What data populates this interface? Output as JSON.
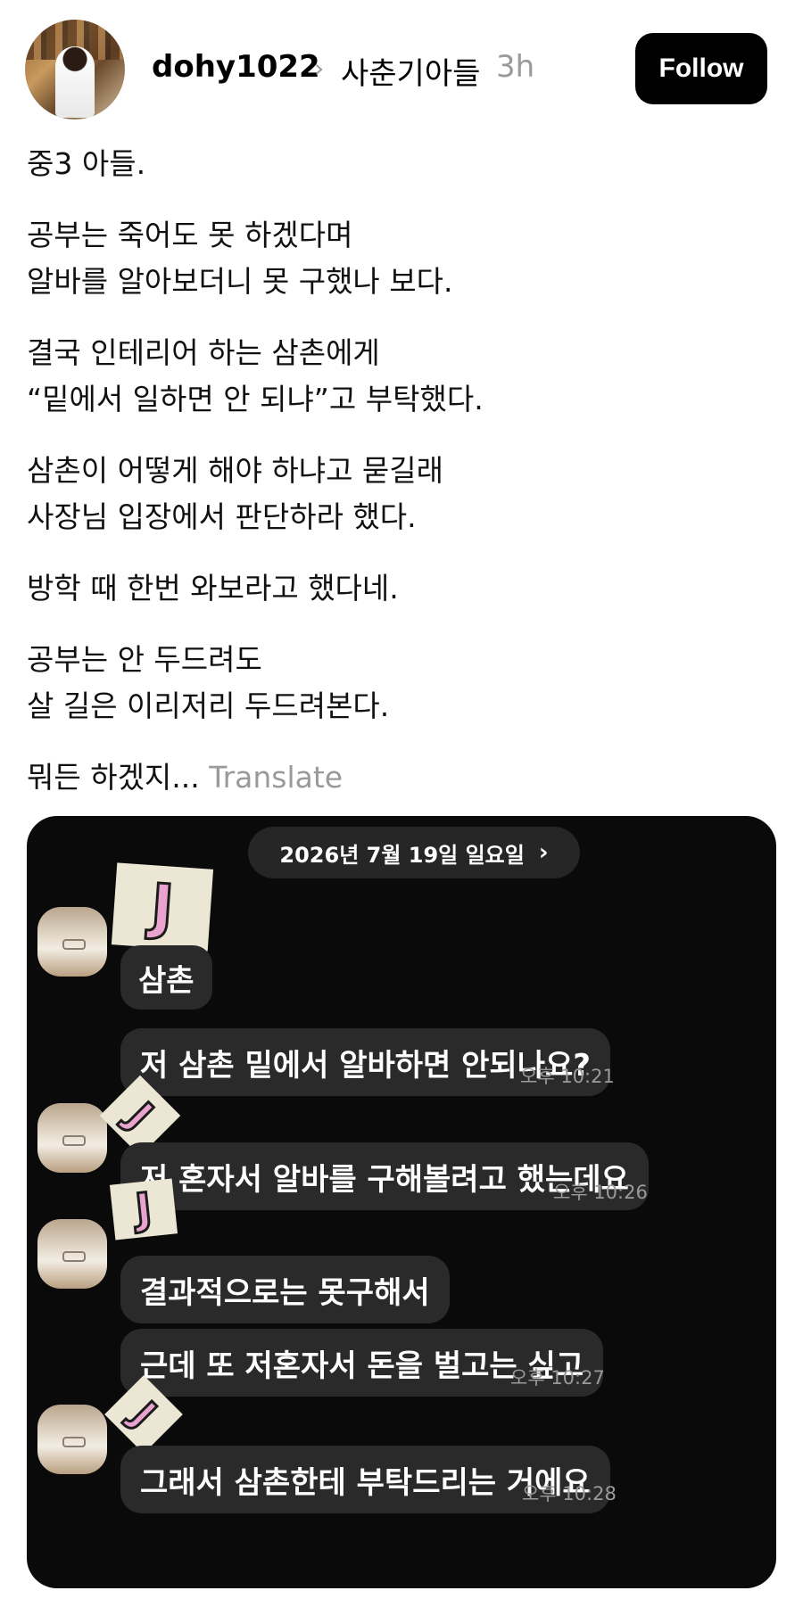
{
  "header": {
    "username": "dohy1022",
    "chevron": "›",
    "group": "사춘기아들",
    "time": "3h",
    "follow_label": "Follow"
  },
  "post": {
    "paragraphs": [
      [
        "중3 아들."
      ],
      [
        "공부는 죽어도 못 하겠다며",
        "알바를 알아보더니 못 구했나 보다."
      ],
      [
        "결국 인테리어 하는 삼촌에게",
        "“밑에서 일하면 안 되냐”고 부탁했다."
      ],
      [
        "삼촌이 어떻게 해야 하냐고 묻길래",
        "사장님 입장에서 판단하라 했다."
      ],
      [
        "방학 때 한번 와보라고 했다네."
      ],
      [
        "공부는 안 두드려도",
        "살 길은 이리저리 두드려본다."
      ]
    ],
    "last_line": "뭐든 하겠지...",
    "translate_label": "Translate"
  },
  "chat": {
    "date_label": "2026년 7월 19일 일요일",
    "date_chevron": "›",
    "sticker_letter": "J",
    "sender_name": "삼촌",
    "messages": [
      {
        "text": "저 삼촌 밑에서 알바하면 안되나요?",
        "time": "오후 10:21"
      },
      {
        "text": "저 혼자서 알바를 구해볼려고 했는데요",
        "time": "오후 10:26"
      },
      {
        "text": "결과적으로는 못구해서",
        "time": ""
      },
      {
        "text": "근데 또 저혼자서 돈을 벌고는 싶고",
        "time": "오후 10:27"
      },
      {
        "text": "그래서 삼촌한테 부탁드리는 거에요",
        "time": "오후 10:28"
      }
    ]
  },
  "colors": {
    "follow_bg": "#000000",
    "chat_bg": "#0a0a0a",
    "bubble_bg": "#2a2a2a",
    "muted": "#9a9a9a",
    "sticker_bg": "#ece7d4",
    "sticker_letter": "#e9a3cf"
  },
  "icons": [
    "chevron-right-icon"
  ]
}
